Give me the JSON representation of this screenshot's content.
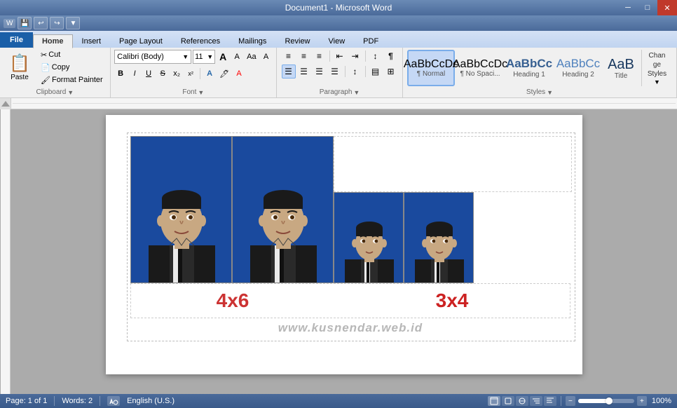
{
  "titlebar": {
    "title": "Document1 - Microsoft Word",
    "minimize": "─",
    "maximize": "□",
    "close": "✕"
  },
  "quickaccess": {
    "buttons": [
      "💾",
      "↩",
      "↪"
    ]
  },
  "ribbon": {
    "tabs": [
      "File",
      "Home",
      "Insert",
      "Page Layout",
      "References",
      "Mailings",
      "Review",
      "View",
      "PDF"
    ],
    "active_tab": "Home",
    "font": {
      "name": "Calibri (Body)",
      "size": "11",
      "grow_label": "A",
      "shrink_label": "A",
      "clear_label": "A",
      "bold": "B",
      "italic": "I",
      "underline": "U",
      "strikethrough": "S",
      "subscript": "x₂",
      "superscript": "x²",
      "group_label": "Font"
    },
    "paragraph": {
      "bullets": "≡",
      "numbering": "≡",
      "multi_level": "≡",
      "decrease_indent": "⇤",
      "increase_indent": "⇥",
      "sort": "↕",
      "show_hide": "¶",
      "align_left": "≡",
      "align_center": "≡",
      "align_right": "≡",
      "justify": "≡",
      "line_spacing": "↕",
      "shading": "▤",
      "borders": "⊞",
      "group_label": "Paragraph"
    },
    "styles": {
      "items": [
        {
          "label": "¶ Normal",
          "name": "Normal",
          "active": true
        },
        {
          "label": "¶ No Spaci...",
          "name": "No Spacing"
        },
        {
          "label": "Heading 1",
          "name": "Heading 1"
        },
        {
          "label": "Heading 2",
          "name": "Heading 2"
        },
        {
          "label": "Title",
          "name": "Title"
        },
        {
          "label": "Chan\nStyles",
          "name": "Change Styles"
        }
      ],
      "group_label": "Styles"
    },
    "clipboard": {
      "paste_label": "Paste",
      "cut_label": "Cut",
      "copy_label": "Copy",
      "format_painter_label": "Format Painter",
      "group_label": "Clipboard"
    }
  },
  "document": {
    "label_4x6": "4x6",
    "label_3x4": "3x4",
    "watermark": "www.kusnendar.web.id"
  },
  "statusbar": {
    "page": "Page: 1 of 1",
    "words": "Words: 2",
    "language": "English (U.S.)",
    "zoom_percent": "100%",
    "view_icons": [
      "📄",
      "📋",
      "📑",
      "🔍"
    ]
  }
}
